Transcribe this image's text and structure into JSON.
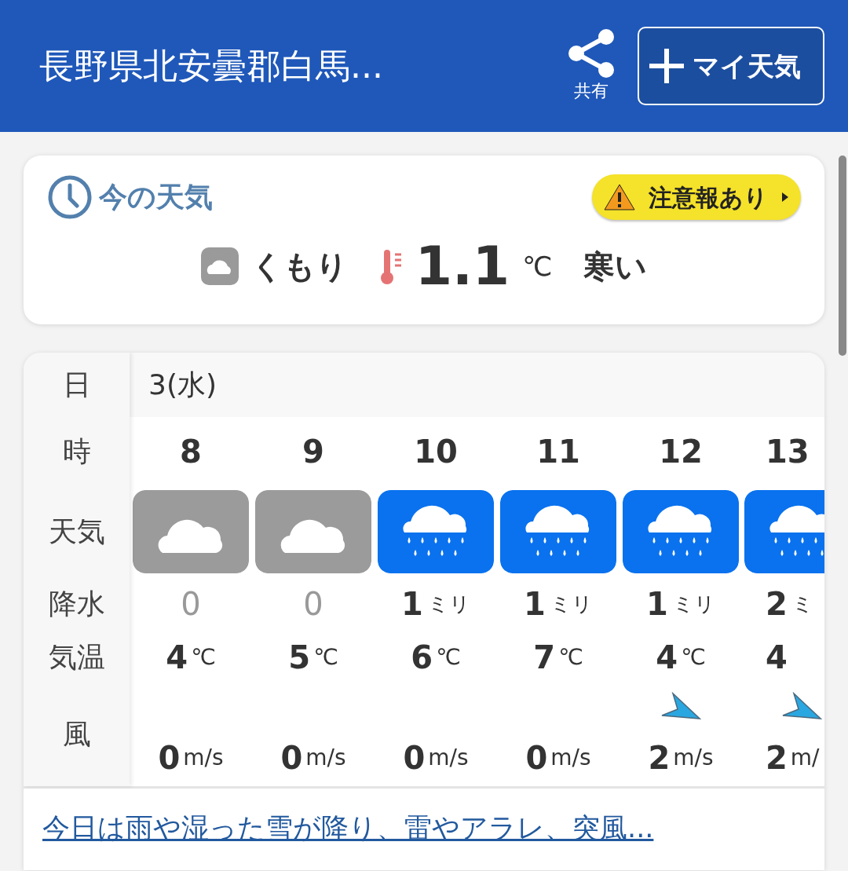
{
  "header": {
    "title": "長野県北安曇郡白馬...",
    "share_label": "共有",
    "my_weather_button": "マイ天気"
  },
  "current": {
    "title": "今の天気",
    "alert": "注意報あり",
    "condition": "くもり",
    "temperature": "1.1",
    "temp_unit": "℃",
    "feeling": "寒い"
  },
  "forecast": {
    "row_labels": [
      "日",
      "時",
      "天気",
      "降水",
      "気温",
      "風"
    ],
    "date": "3(水)",
    "hours": [
      {
        "hour": "8",
        "kind": "cloudy",
        "precip": "0",
        "temp": "4",
        "temp_unit": "℃",
        "wind_arrow": false,
        "wind": "0",
        "wind_unit": "m/s"
      },
      {
        "hour": "9",
        "kind": "cloudy",
        "precip": "0",
        "temp": "5",
        "temp_unit": "℃",
        "wind_arrow": false,
        "wind": "0",
        "wind_unit": "m/s"
      },
      {
        "hour": "10",
        "kind": "rain",
        "precip": "1",
        "precip_unit": "ミリ",
        "temp": "6",
        "temp_unit": "℃",
        "wind_arrow": false,
        "wind": "0",
        "wind_unit": "m/s"
      },
      {
        "hour": "11",
        "kind": "rain",
        "precip": "1",
        "precip_unit": "ミリ",
        "temp": "7",
        "temp_unit": "℃",
        "wind_arrow": false,
        "wind": "0",
        "wind_unit": "m/s"
      },
      {
        "hour": "12",
        "kind": "rain",
        "precip": "1",
        "precip_unit": "ミリ",
        "temp": "4",
        "temp_unit": "℃",
        "wind_arrow": true,
        "wind": "2",
        "wind_unit": "m/s"
      },
      {
        "hour": "13",
        "kind": "rain",
        "precip": "2",
        "precip_unit": "ミ",
        "temp": "4",
        "wind_arrow": true,
        "wind": "2",
        "wind_unit": "m/"
      }
    ]
  },
  "summary_link": "今日は雨や湿った雪が降り、雷やアラレ、突風..."
}
